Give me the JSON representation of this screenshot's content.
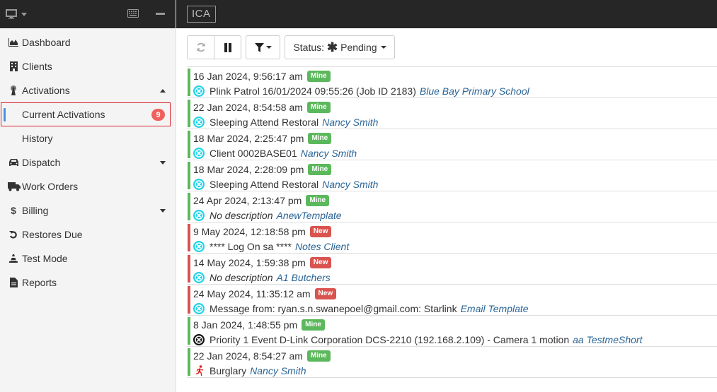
{
  "header": {
    "logo": "ICA"
  },
  "sidebar": {
    "icons": {
      "monitor": "monitor-icon",
      "keyboard": "keyboard-icon",
      "minimize": "minimize-icon"
    },
    "items": [
      {
        "label": "Dashboard",
        "icon": "area-chart-icon"
      },
      {
        "label": "Clients",
        "icon": "building-icon"
      },
      {
        "label": "Activations",
        "icon": "broadcast-tower-icon",
        "expanded": true
      },
      {
        "label": "Current Activations",
        "badge": "9",
        "active": true
      },
      {
        "label": "History"
      },
      {
        "label": "Dispatch",
        "icon": "car-icon",
        "expanded": false
      },
      {
        "label": "Work Orders",
        "icon": "truck-icon"
      },
      {
        "label": "Billing",
        "icon": "dollar-icon",
        "expanded": false
      },
      {
        "label": "Restores Due",
        "icon": "undo-icon"
      },
      {
        "label": "Test Mode",
        "icon": "traffic-cone-icon"
      },
      {
        "label": "Reports",
        "icon": "file-icon"
      }
    ]
  },
  "toolbar": {
    "refresh_icon": "refresh-icon",
    "pause_icon": "pause-icon",
    "filter_icon": "filter-icon",
    "status_label": "Status:",
    "status_icon": "asterisk-icon",
    "status_value": "Pending"
  },
  "colors": {
    "mine": "#5cb85c",
    "new": "#d9534f",
    "link": "#2a6496",
    "badge": "#f0605d",
    "icon_cyan": "#22d3e8",
    "icon_burglary": "#e31b1b"
  },
  "activations": [
    {
      "timestamp": "16 Jan 2024, 9:56:17 am",
      "badge": "Mine",
      "status": "mine",
      "icon": "times-circle-cyan-icon",
      "description": "Plink Patrol 16/01/2024 09:55:26 (Job ID 2183)",
      "italic": false,
      "client": "Blue Bay Primary School"
    },
    {
      "timestamp": "22 Jan 2024, 8:54:58 am",
      "badge": "Mine",
      "status": "mine",
      "icon": "times-circle-cyan-icon",
      "description": "Sleeping Attend Restoral",
      "italic": false,
      "client": "Nancy Smith"
    },
    {
      "timestamp": "18 Mar 2024, 2:25:47 pm",
      "badge": "Mine",
      "status": "mine",
      "icon": "times-circle-cyan-icon",
      "description": "Client 0002BASE01",
      "italic": false,
      "client": "Nancy Smith"
    },
    {
      "timestamp": "18 Mar 2024, 2:28:09 pm",
      "badge": "Mine",
      "status": "mine",
      "icon": "times-circle-cyan-icon",
      "description": "Sleeping Attend Restoral",
      "italic": false,
      "client": "Nancy Smith"
    },
    {
      "timestamp": "24 Apr 2024, 2:13:47 pm",
      "badge": "Mine",
      "status": "mine",
      "icon": "times-circle-cyan-icon",
      "description": "No description",
      "italic": true,
      "client": "AnewTemplate"
    },
    {
      "timestamp": "9 May 2024, 12:18:58 pm",
      "badge": "New",
      "status": "new",
      "icon": "times-circle-cyan-icon",
      "description": "**** Log On sa ****",
      "italic": false,
      "client": "Notes Client"
    },
    {
      "timestamp": "14 May 2024, 1:59:38 pm",
      "badge": "New",
      "status": "new",
      "icon": "times-circle-cyan-icon",
      "description": "No description",
      "italic": true,
      "client": "A1 Butchers"
    },
    {
      "timestamp": "24 May 2024, 11:35:12 am",
      "badge": "New",
      "status": "new",
      "icon": "times-circle-cyan-icon",
      "description": "Message from: ryan.s.n.swanepoel@gmail.com: Starlink",
      "italic": false,
      "client": "Email Template"
    },
    {
      "timestamp": "8 Jan 2024, 1:48:55 pm",
      "badge": "Mine",
      "status": "mine",
      "icon": "times-circle-black-icon",
      "description": "Priority 1 Event D-Link Corporation DCS-2210 (192.168.2.109) - Camera 1 motion",
      "italic": false,
      "client": "aa TestmeShort"
    },
    {
      "timestamp": "22 Jan 2024, 8:54:27 am",
      "badge": "Mine",
      "status": "mine",
      "icon": "running-person-icon",
      "description": "Burglary",
      "italic": false,
      "client": "Nancy Smith"
    }
  ]
}
